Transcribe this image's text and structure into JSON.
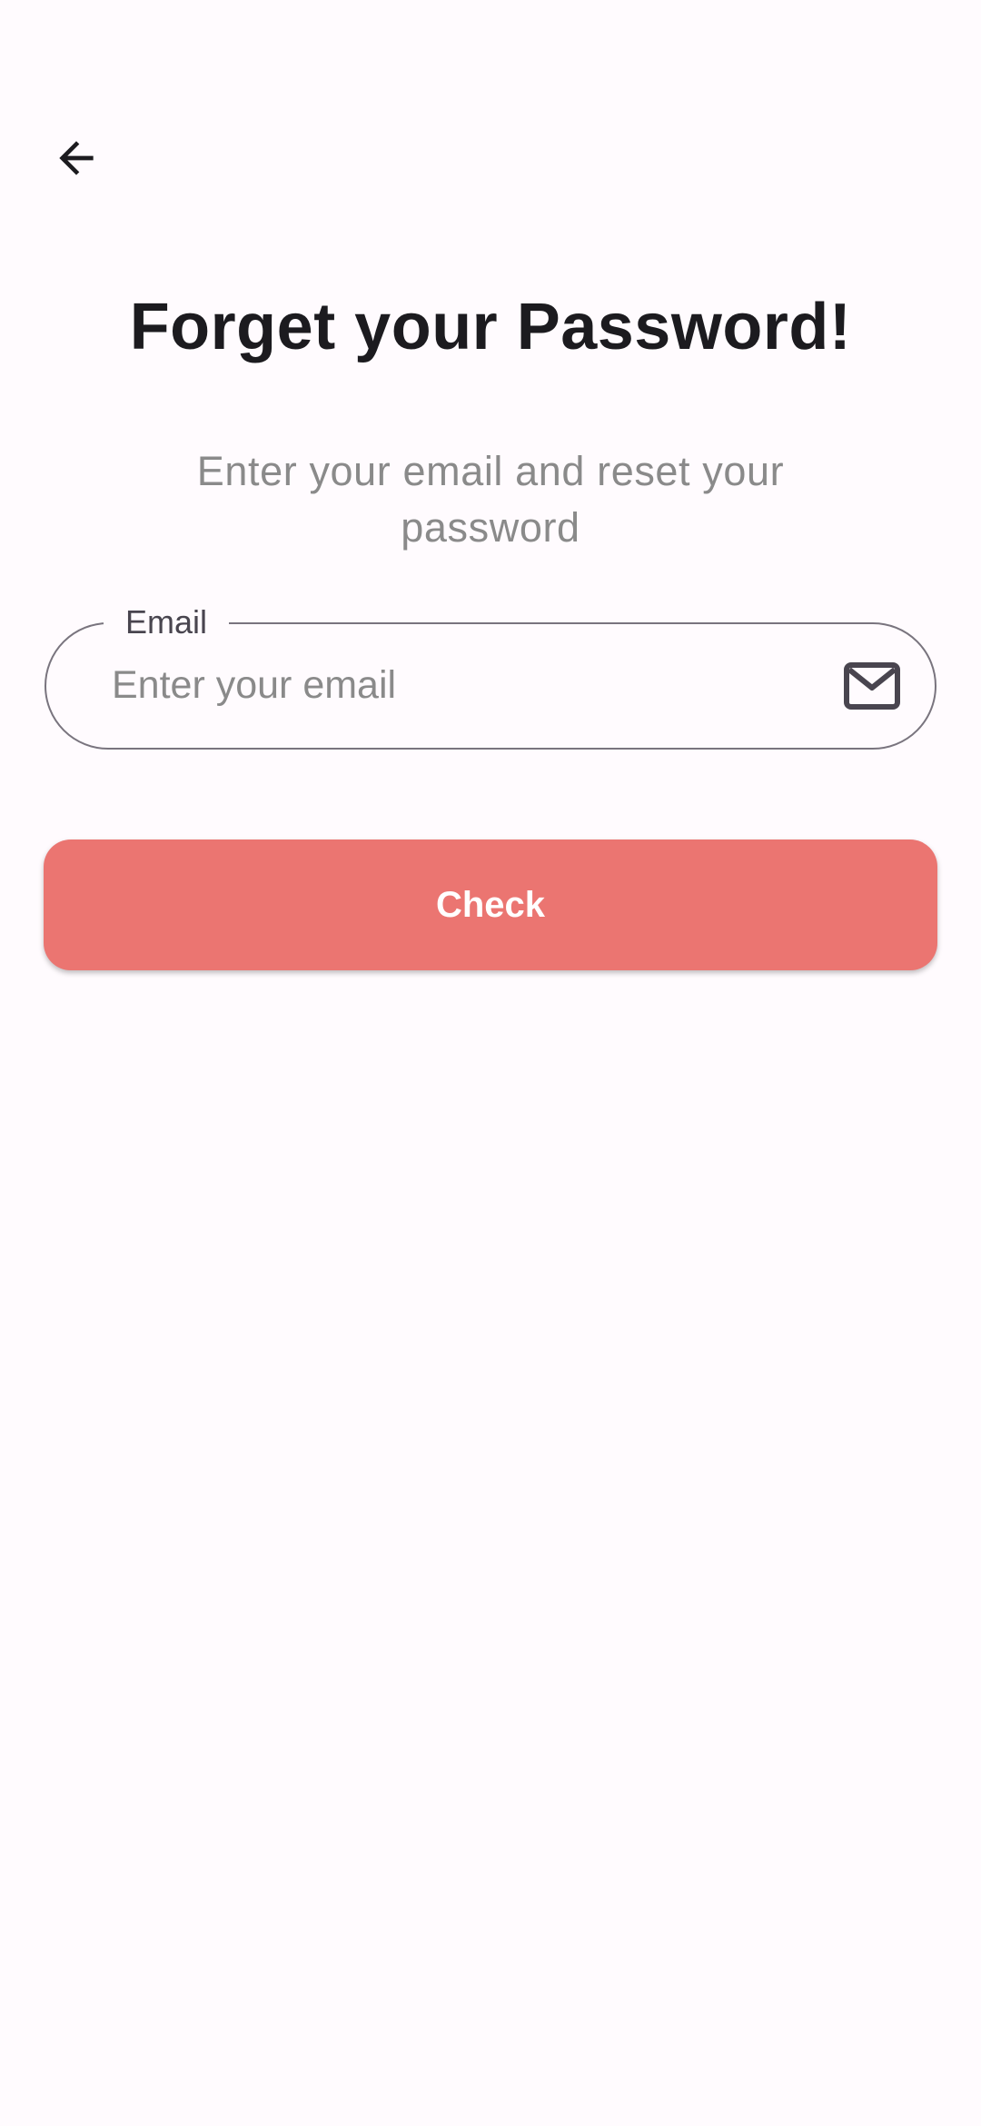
{
  "header": {
    "back_icon": "arrow-left-icon"
  },
  "title": "Forget your Password!",
  "subtitle": "Enter your email and reset your password",
  "email_field": {
    "label": "Email",
    "placeholder": "Enter your email",
    "value": "",
    "icon": "mail-icon"
  },
  "check_button": {
    "label": "Check",
    "color": "#eb7571"
  },
  "colors": {
    "background": "#fffbfe",
    "title": "#1c1b1f",
    "subtitle": "#8a8a8a",
    "field_border": "#79747e"
  }
}
